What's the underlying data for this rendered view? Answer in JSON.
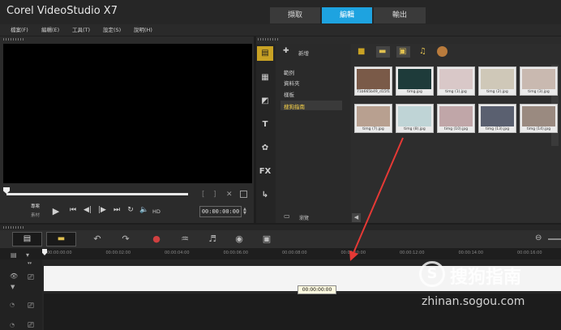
{
  "app": {
    "title": "Corel VideoStudio X7"
  },
  "mode_tabs": [
    "擷取",
    "編輯",
    "輸出"
  ],
  "menu": [
    "檔案(F)",
    "編輯(E)",
    "工具(T)",
    "設定(S)",
    "說明(H)"
  ],
  "library": {
    "add_label": "新增",
    "categories": [
      "範例",
      "資料夾",
      "樣板",
      "搜狗指南"
    ],
    "selected_category": "搜狗指南",
    "browse_label": "瀏覽",
    "thumbnails": [
      {
        "label": "71b665b49_d15f18108...",
        "color": "#7a5a48"
      },
      {
        "label": "timg.jpg",
        "color": "#1e3b3a"
      },
      {
        "label": "timg (1).jpg",
        "color": "#d9c8c8"
      },
      {
        "label": "timg (2).jpg",
        "color": "#cfc8b8"
      },
      {
        "label": "timg (3).jpg",
        "color": "#c9b9b0"
      },
      {
        "label": "timg (7).jpg",
        "color": "#b8a090"
      },
      {
        "label": "timg (8).jpg",
        "color": "#bfd4d6"
      },
      {
        "label": "timg (10).jpg",
        "color": "#c0a6a8"
      },
      {
        "label": "timg (13).jpg",
        "color": "#5a6070"
      },
      {
        "label": "timg (14).jpg",
        "color": "#9a8a80"
      }
    ]
  },
  "player": {
    "project_label": "專案",
    "clip_label": "素材",
    "hd_label": "HD",
    "timecode": "00:00:00:00"
  },
  "timeline": {
    "ticks": [
      "00:00:00:00",
      "00:00:02:00",
      "00:00:04:00",
      "00:00:06:00",
      "00:00:08:00",
      "00:00:10:00",
      "00:00:12:00",
      "00:00:14:00",
      "00:00:16:00"
    ],
    "tooltip": "00:00:00:00"
  },
  "watermark": {
    "brand": "搜狗指南",
    "url": "zhinan.sogou.com"
  },
  "colors": {
    "accent": "#1ea3e0",
    "arrow": "#e53935"
  }
}
